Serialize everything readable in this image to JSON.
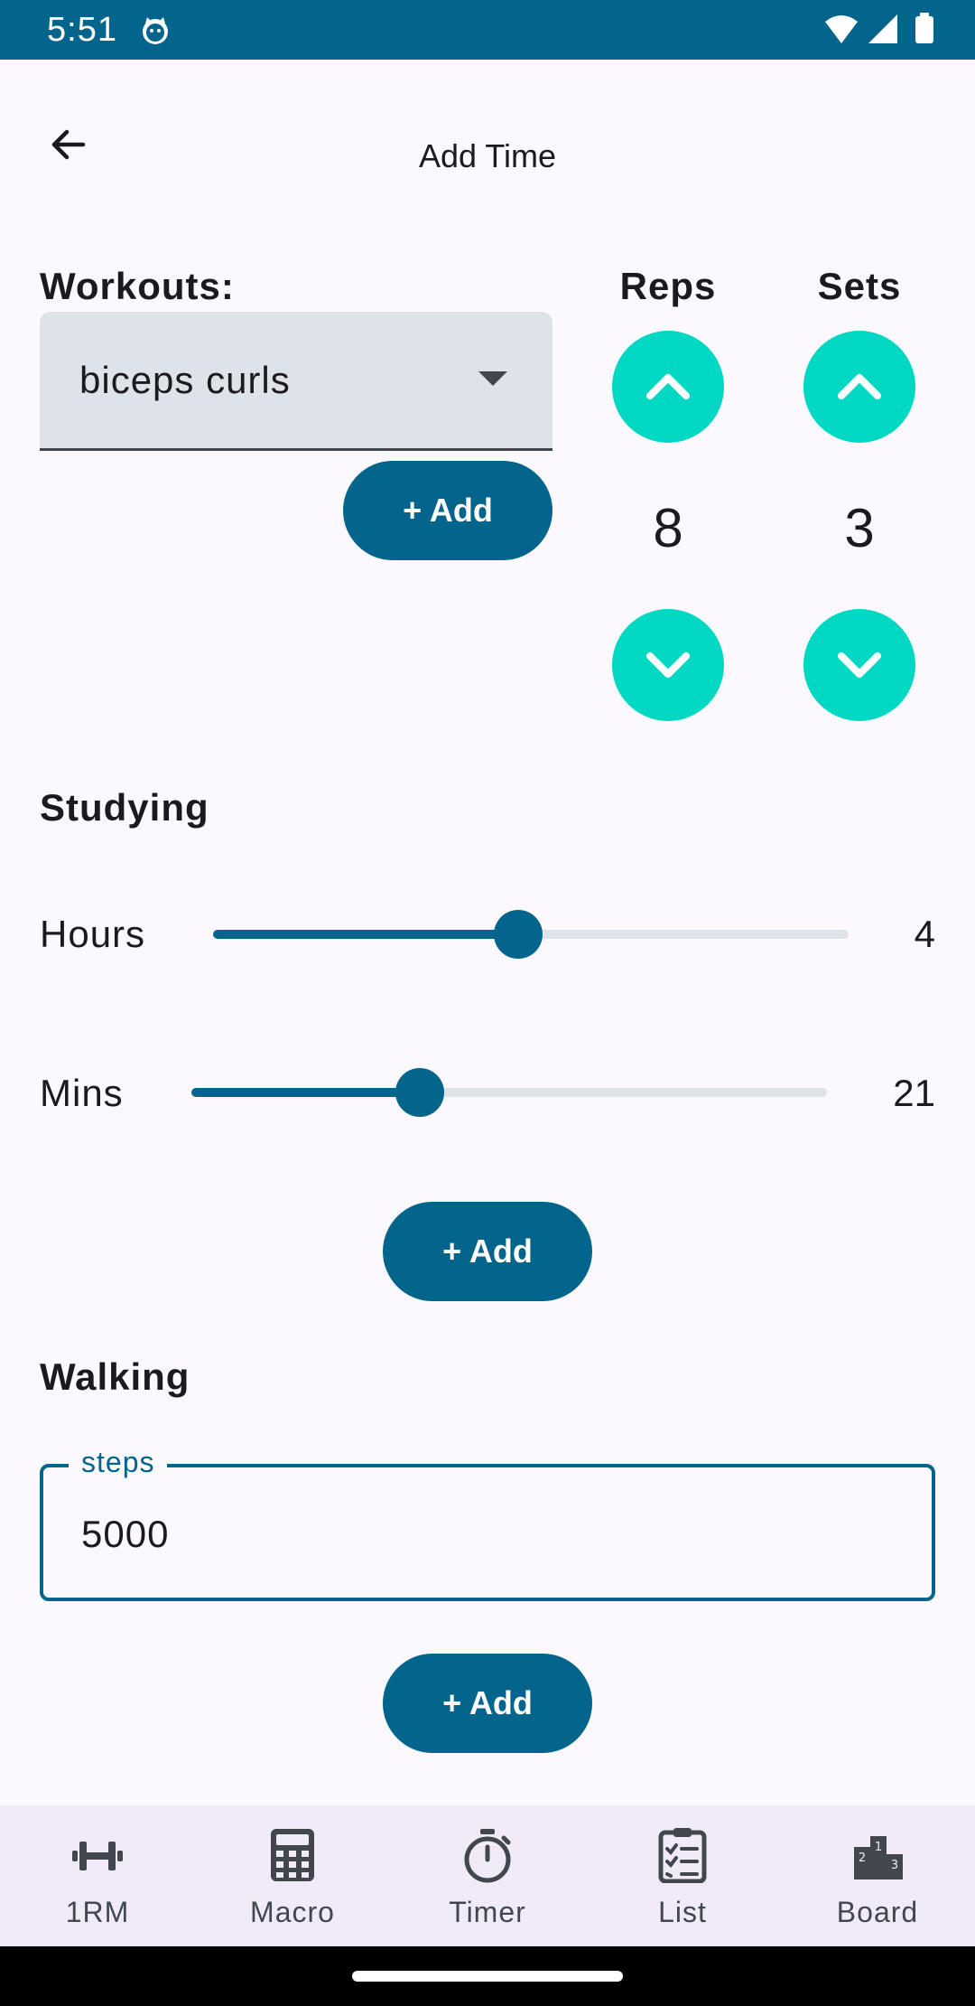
{
  "status_bar": {
    "time": "5:51",
    "icons": [
      "cat-notification-icon",
      "wifi-icon",
      "signal-icon",
      "battery-icon"
    ]
  },
  "app_bar": {
    "title": "Add Time",
    "back_icon": "arrow-back-icon"
  },
  "workouts": {
    "label": "Workouts:",
    "selected": "biceps curls",
    "add_label": "+ Add",
    "reps": {
      "label": "Reps",
      "value": "8"
    },
    "sets": {
      "label": "Sets",
      "value": "3"
    }
  },
  "studying": {
    "title": "Studying",
    "hours": {
      "label": "Hours",
      "value": "4",
      "fraction": 0.48
    },
    "mins": {
      "label": "Mins",
      "value": "21",
      "fraction": 0.36
    },
    "add_label": "+ Add"
  },
  "walking": {
    "title": "Walking",
    "field_label": "steps",
    "field_value": "5000",
    "add_label": "+ Add"
  },
  "bottom_nav": {
    "items": [
      {
        "label": "1RM",
        "icon": "dumbbell-icon"
      },
      {
        "label": "Macro",
        "icon": "calculator-icon"
      },
      {
        "label": "Timer",
        "icon": "stopwatch-icon"
      },
      {
        "label": "List",
        "icon": "checklist-icon"
      },
      {
        "label": "Board",
        "icon": "podium-icon"
      }
    ]
  },
  "colors": {
    "primary": "#03658c",
    "accent": "#00d8c3",
    "background": "#fbf9fd",
    "nav_background": "#f1ebf9"
  }
}
